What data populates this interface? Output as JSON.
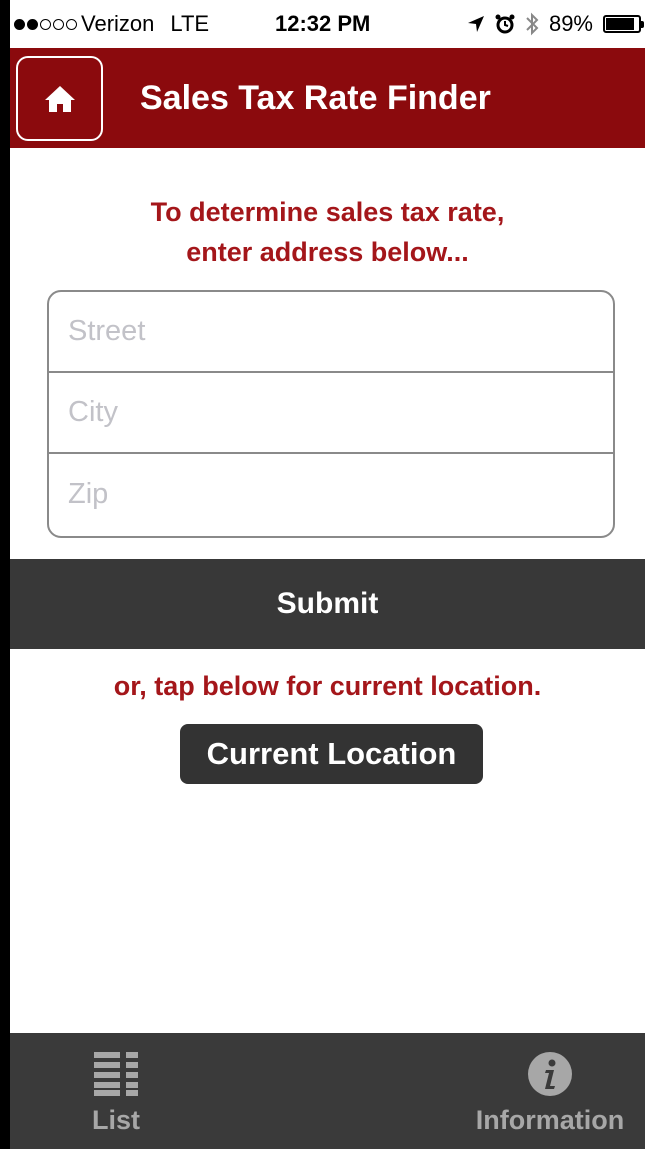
{
  "status_bar": {
    "carrier": "Verizon",
    "network": "LTE",
    "time": "12:32 PM",
    "battery": "89%",
    "battery_level": 0.89,
    "icons": [
      "signal-dots-icon",
      "location-arrow-icon",
      "alarm-icon",
      "bluetooth-icon",
      "battery-icon"
    ]
  },
  "header": {
    "title": "Sales Tax Rate Finder",
    "home_icon": "home-icon"
  },
  "form": {
    "instruction_line1": "To determine sales tax rate,",
    "instruction_line2": "enter address below...",
    "fields": [
      {
        "placeholder": "Street",
        "value": ""
      },
      {
        "placeholder": "City",
        "value": ""
      },
      {
        "placeholder": "Zip",
        "value": ""
      }
    ],
    "submit_label": "Submit"
  },
  "location": {
    "prompt": "or, tap below for current location.",
    "button_label": "Current Location"
  },
  "tab_bar": {
    "tabs": [
      {
        "label": "List",
        "icon": "list-icon"
      },
      {
        "label": "Information",
        "icon": "info-icon"
      }
    ]
  },
  "colors": {
    "brand_red": "#8b0a0d",
    "text_red": "#a4161a",
    "dark_bar": "#383838",
    "tab_bar": "#3a3a3a"
  }
}
